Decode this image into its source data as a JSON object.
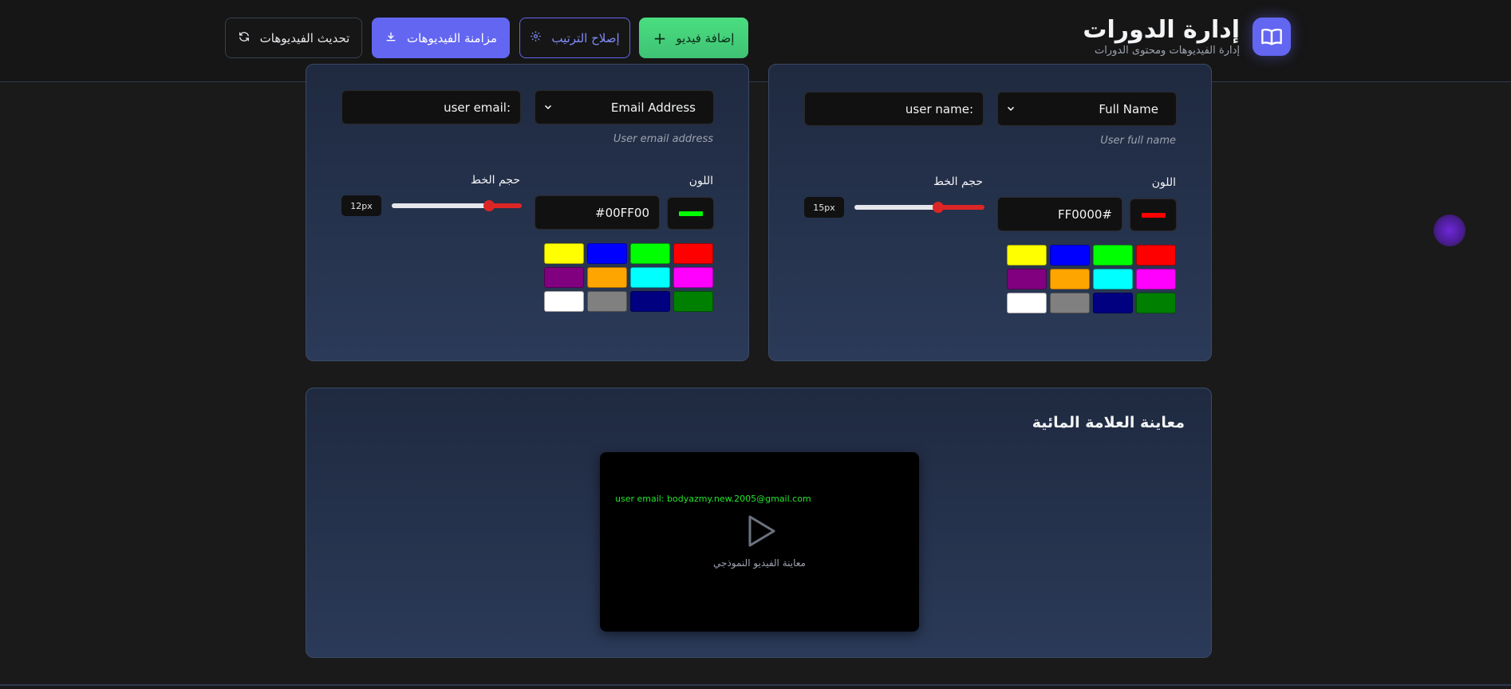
{
  "header": {
    "title": "إدارة الدورات",
    "subtitle": "إدارة الفيديوهات ومحتوى الدورات",
    "logo_icon": "book-open-icon",
    "buttons": {
      "add_video": "إضافة فيديو",
      "fix_order": "إصلاح الترتيب",
      "sync_videos": "مزامنة الفيديوهات",
      "refresh_videos": "تحديث الفيديوهات"
    }
  },
  "watermark_left": {
    "field_select": "Email Address",
    "text_input": "user email:",
    "hint": "User email address",
    "color_label": "اللون",
    "size_label": "حجم الخط",
    "color_hex": "#00FF00",
    "size_value": "12px",
    "size_level": 0.75
  },
  "watermark_right": {
    "field_select": "Full Name",
    "text_input": "user name:",
    "hint": "User full name",
    "color_label": "اللون",
    "size_label": "حجم الخط",
    "color_hex": "#FF0000",
    "size_value": "15px",
    "size_level": 0.65
  },
  "palette_colors": [
    "#ff0000",
    "#00ff00",
    "#0000ff",
    "#ffff00",
    "#ff00ff",
    "#00ffff",
    "#ffa500",
    "#800080",
    "#008000",
    "#000080",
    "#808080",
    "#ffffff"
  ],
  "preview": {
    "title": "معاينة العلامة المائية",
    "watermark_text": "user email: bodyazmy.new.2005@gmail.com",
    "caption": "معاينة الفيديو النموذجي"
  }
}
